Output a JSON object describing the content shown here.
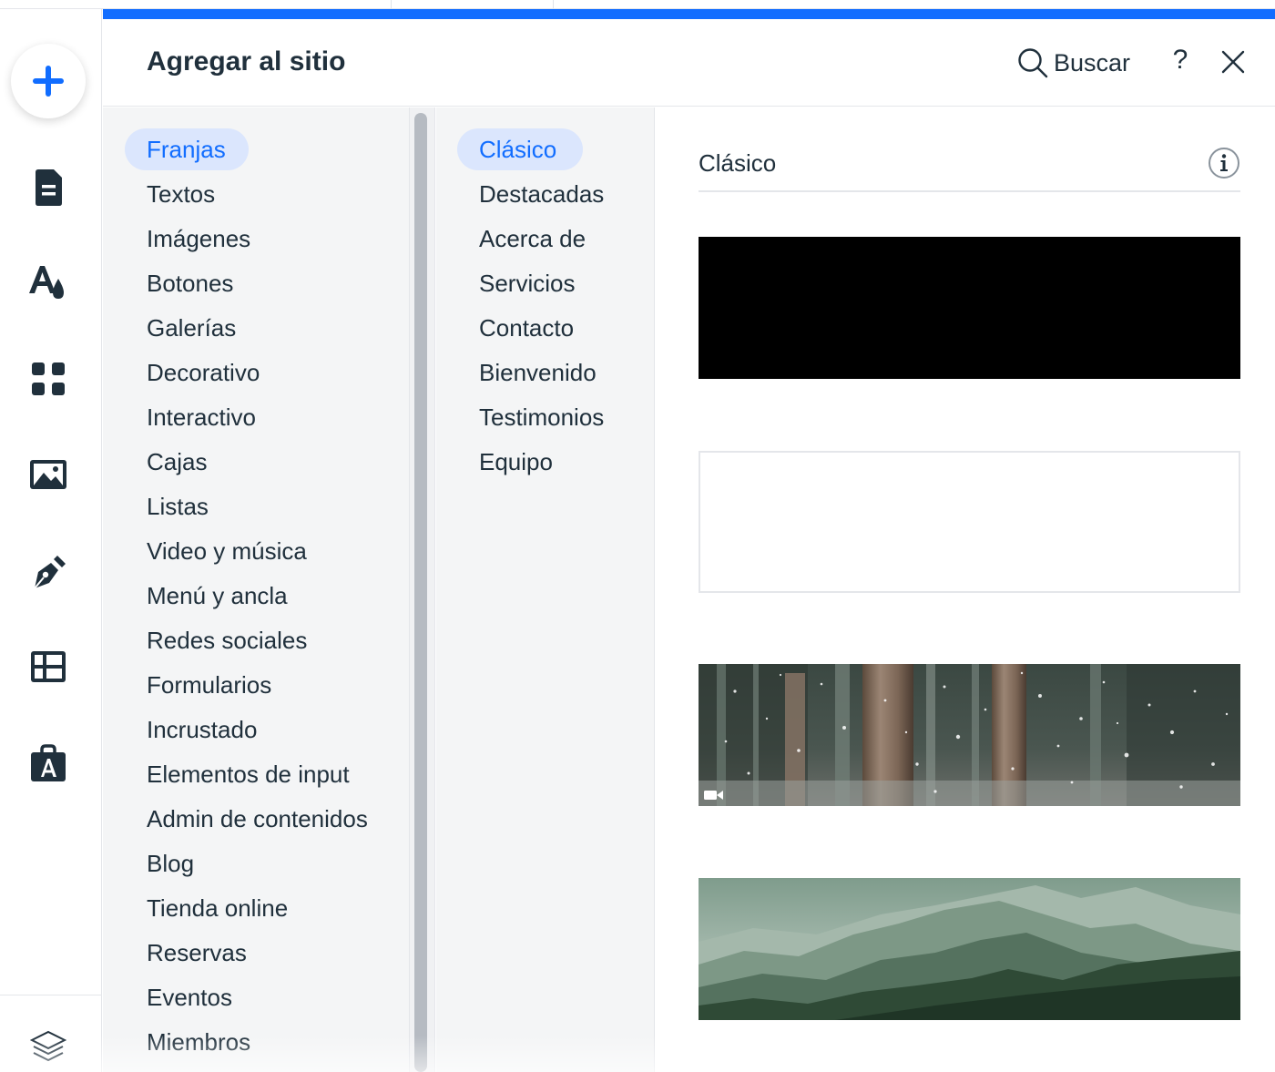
{
  "panel": {
    "title": "Agregar al sitio",
    "search_label": "Buscar",
    "help_label": "?"
  },
  "rail": {
    "items": [
      "add-button",
      "pages-icon",
      "theme-icon",
      "apps-icon",
      "media-icon",
      "draw-icon",
      "table-icon",
      "store-icon",
      "layers-icon"
    ]
  },
  "categories": [
    "Franjas",
    "Textos",
    "Imágenes",
    "Botones",
    "Galerías",
    "Decorativo",
    "Interactivo",
    "Cajas",
    "Listas",
    "Video y música",
    "Menú y ancla",
    "Redes sociales",
    "Formularios",
    "Incrustado",
    "Elementos de input",
    "Admin de contenidos",
    "Blog",
    "Tienda online",
    "Reservas",
    "Eventos",
    "Miembros"
  ],
  "selected_category": "Franjas",
  "subcategories": [
    "Clásico",
    "Destacadas",
    "Acerca de",
    "Servicios",
    "Contacto",
    "Bienvenido",
    "Testimonios",
    "Equipo"
  ],
  "selected_subcategory": "Clásico",
  "preview": {
    "section_title": "Clásico",
    "strips": [
      "black-strip",
      "white-strip",
      "snowy-forest-video-strip",
      "green-mountains-strip"
    ]
  },
  "colors": {
    "accent": "#116dff",
    "selection_bg": "#dbe6fd",
    "text": "#20303c"
  }
}
